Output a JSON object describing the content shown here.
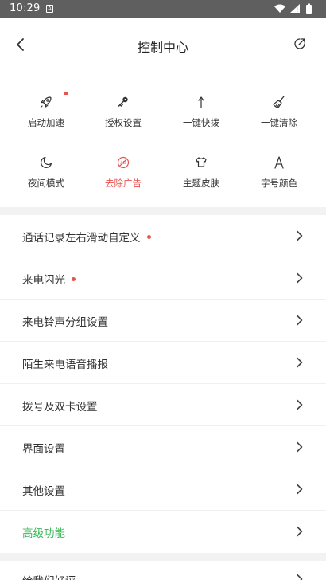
{
  "status_bar": {
    "time": "10:29",
    "notification": "A"
  },
  "header": {
    "title": "控制中心"
  },
  "grid": [
    {
      "label": "启动加速",
      "icon": "rocket-icon",
      "badge": true
    },
    {
      "label": "授权设置",
      "icon": "key-icon",
      "badge": false
    },
    {
      "label": "一键快拨",
      "icon": "dial-arrow-icon",
      "badge": false
    },
    {
      "label": "一键清除",
      "icon": "broom-icon",
      "badge": false
    },
    {
      "label": "夜间模式",
      "icon": "moon-icon",
      "badge": false
    },
    {
      "label": "去除广告",
      "icon": "no-ads-icon",
      "badge": false,
      "highlight": true
    },
    {
      "label": "主题皮肤",
      "icon": "shirt-icon",
      "badge": false
    },
    {
      "label": "字号颜色",
      "icon": "font-icon",
      "badge": false
    }
  ],
  "settings": [
    {
      "label": "通话记录左右滑动自定义",
      "dot": true
    },
    {
      "label": "来电闪光",
      "dot": true
    },
    {
      "label": "来电铃声分组设置",
      "dot": false
    },
    {
      "label": "陌生来电语音播报",
      "dot": false
    },
    {
      "label": "拨号及双卡设置",
      "dot": false
    },
    {
      "label": "界面设置",
      "dot": false
    },
    {
      "label": "其他设置",
      "dot": false
    },
    {
      "label": "高级功能",
      "dot": false,
      "accent": true
    }
  ],
  "extra": {
    "label": "给我们好评"
  },
  "colors": {
    "accent_red": "#e8524f",
    "accent_green": "#3cba5a",
    "status_bar": "#5f5f5f"
  }
}
